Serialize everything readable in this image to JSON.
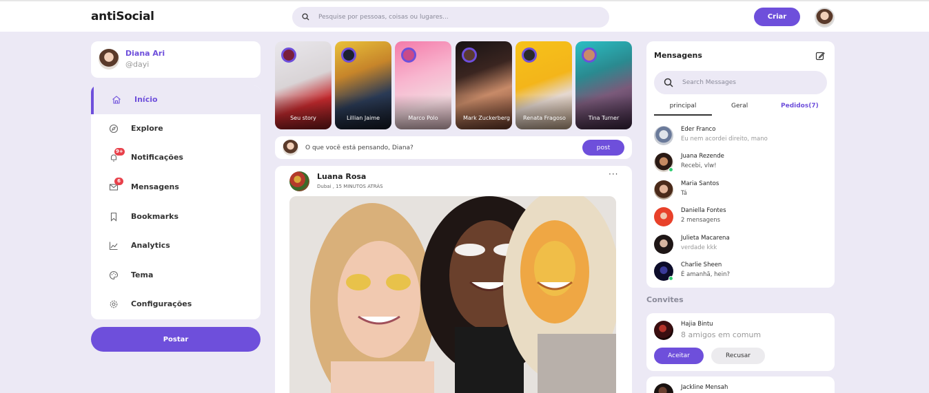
{
  "navbar": {
    "logo": "antiSocial",
    "search_placeholder": "Pesquise por pessoas, coisas ou lugares...",
    "create_label": "Criar"
  },
  "profile": {
    "name": "Diana Ari",
    "handle": "@dayi"
  },
  "menu": {
    "items": [
      {
        "label": "Início",
        "icon": "home-icon",
        "active": true
      },
      {
        "label": "Explore",
        "icon": "compass-icon"
      },
      {
        "label": "Notificações",
        "icon": "bell-icon",
        "badge": "9+"
      },
      {
        "label": "Mensagens",
        "icon": "mail-icon",
        "badge": "6"
      },
      {
        "label": "Bookmarks",
        "icon": "bookmark-icon"
      },
      {
        "label": "Analytics",
        "icon": "chart-icon"
      },
      {
        "label": "Tema",
        "icon": "palette-icon"
      },
      {
        "label": "Configurações",
        "icon": "gear-icon"
      }
    ],
    "post_button": "Postar"
  },
  "stories": [
    {
      "name": "Seu story"
    },
    {
      "name": "Lillian Jaime"
    },
    {
      "name": "Marco Polo"
    },
    {
      "name": "Mark Zuckerberg"
    },
    {
      "name": "Renata Fragoso"
    },
    {
      "name": "Tina Turner"
    }
  ],
  "create_post": {
    "placeholder": "O que você está pensando, Diana?",
    "post_button": "post"
  },
  "feed": {
    "author": "Luana Rosa",
    "meta": "Dubai , 15 MINUTOS ATRÁS",
    "more": "···"
  },
  "messages": {
    "title": "Mensagens",
    "search_placeholder": "Search Messages",
    "tabs": [
      "principal",
      "Geral",
      "Pedidos(7)"
    ],
    "items": [
      {
        "name": "Eder Franco",
        "text": "Eu nem acordei direito, mano"
      },
      {
        "name": "Juana Rezende",
        "text": "Recebi, vlw!"
      },
      {
        "name": "Maria Santos",
        "text": "Tá"
      },
      {
        "name": "Daniella Fontes",
        "text": "2 mensagens"
      },
      {
        "name": "Julieta Macarena",
        "text": "verdade kkk"
      },
      {
        "name": "Charlie Sheen",
        "text": "É amanhã, hein?"
      }
    ]
  },
  "invites": {
    "title": "Convites",
    "items": [
      {
        "name": "Hajia Bintu",
        "mutual": "8 amigos em comum",
        "accept": "Aceitar",
        "decline": "Recusar"
      },
      {
        "name": "Jackline Mensah"
      }
    ]
  },
  "colors": {
    "accent": "#6e4fdb",
    "background": "#ece9f5",
    "badge": "#e8414b",
    "online": "#2ecc71"
  }
}
